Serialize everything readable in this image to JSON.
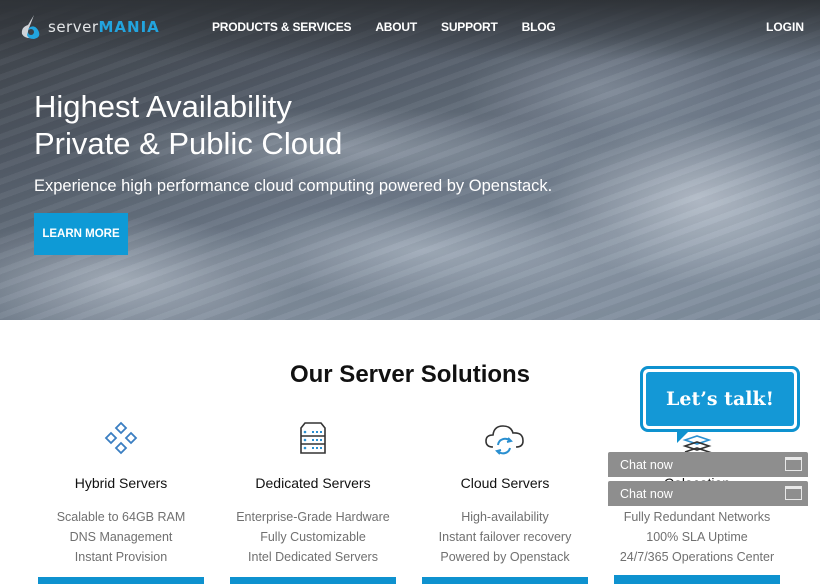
{
  "brand": {
    "name_part1": "server",
    "name_part2": "MANIA",
    "accent": "#0e9ad6"
  },
  "nav": {
    "items": [
      {
        "label": "PRODUCTS & SERVICES"
      },
      {
        "label": "ABOUT"
      },
      {
        "label": "SUPPORT"
      },
      {
        "label": "BLOG"
      }
    ],
    "login": "LOGIN"
  },
  "hero": {
    "title_line1": "Highest Availability",
    "title_line2": "Private & Public Cloud",
    "subtitle": "Experience high performance cloud computing powered by Openstack.",
    "cta": "LEARN MORE"
  },
  "solutions": {
    "title": "Our Server Solutions",
    "columns": [
      {
        "icon": "diamonds-icon",
        "title": "Hybrid Servers",
        "features": [
          "Scalable to 64GB RAM",
          "DNS Management",
          "Instant Provision"
        ]
      },
      {
        "icon": "server-rack-icon",
        "title": "Dedicated Servers",
        "features": [
          "Enterprise-Grade Hardware",
          "Fully Customizable",
          "Intel Dedicated Servers"
        ]
      },
      {
        "icon": "cloud-sync-icon",
        "title": "Cloud Servers",
        "features": [
          "High-availability",
          "Instant failover recovery",
          "Powered by Openstack"
        ]
      },
      {
        "icon": "stack-icon",
        "title": "Colocation",
        "features": [
          "Fully Redundant Networks",
          "100% SLA Uptime",
          "24/7/365 Operations Center"
        ]
      }
    ]
  },
  "chat_widget": {
    "bubble": "Let’s talk!",
    "tabs": [
      {
        "label": "Chat now"
      },
      {
        "label": "Chat now"
      }
    ]
  }
}
